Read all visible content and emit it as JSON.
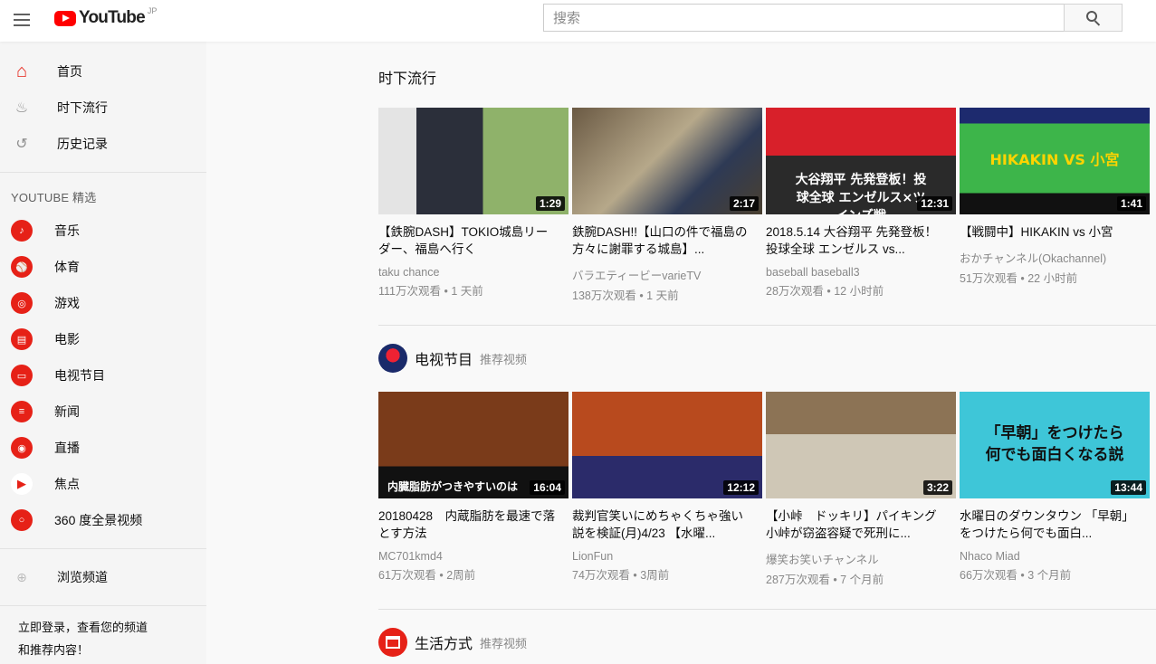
{
  "header": {
    "logo_text": "YouTube",
    "logo_region": "JP",
    "search_placeholder": "搜索"
  },
  "sidebar": {
    "main_items": [
      {
        "label": "首页",
        "icon": "home-icon"
      },
      {
        "label": "时下流行",
        "icon": "flame-icon"
      },
      {
        "label": "历史记录",
        "icon": "history-icon"
      }
    ],
    "best_title": "YOUTUBE 精选",
    "best_items": [
      {
        "label": "音乐",
        "icon": "music-icon"
      },
      {
        "label": "体育",
        "icon": "sports-icon"
      },
      {
        "label": "游戏",
        "icon": "gaming-icon"
      },
      {
        "label": "电影",
        "icon": "film-icon"
      },
      {
        "label": "电视节目",
        "icon": "tv-icon"
      },
      {
        "label": "新闻",
        "icon": "news-icon"
      },
      {
        "label": "直播",
        "icon": "live-icon"
      },
      {
        "label": "焦点",
        "icon": "spotlight-icon"
      },
      {
        "label": "360 度全景视频",
        "icon": "360-icon"
      }
    ],
    "browse_label": "浏览频道",
    "signin_text": "立即登录，查看您的频道和推荐内容！"
  },
  "shelves": [
    {
      "title": "时下流行",
      "subtitle": "",
      "videos": [
        {
          "title": "【鉄腕DASH】TOKIO城島リーダー、福島へ行く",
          "channel": "taku chance",
          "meta": "111万次观看 • 1 天前",
          "duration": "1:29"
        },
        {
          "title": "鉄腕DASH!!【山口の件で福島の方々に謝罪する城島】...",
          "channel": "バラエティービーvarieTV",
          "meta": "138万次观看 • 1 天前",
          "duration": "2:17"
        },
        {
          "title": "2018.5.14 大谷翔平 先発登板！投球全球 エンゼルス vs...",
          "channel": "baseball baseball3",
          "meta": "28万次观看 • 12 小时前",
          "duration": "12:31",
          "overlay": "大谷翔平 先発登板！投球全球 エンゼルス×ツインズ戦"
        },
        {
          "title": "【戦闘中】HIKAKIN vs 小宮",
          "channel": "おかチャンネル(Okachannel)",
          "meta": "51万次观看 • 22 小时前",
          "duration": "1:41",
          "overlay": "HIKAKIN VS 小宮"
        }
      ]
    },
    {
      "title": "电视节目",
      "subtitle": "推荐视频",
      "videos": [
        {
          "title": "20180428　内蔵脂肪を最速で落とす方法",
          "channel": "MC701kmd4",
          "meta": "61万次观看 • 2周前",
          "duration": "16:04",
          "overlay": "内臓脂肪がつきやすいのは"
        },
        {
          "title": "裁判官笑いにめちゃくちゃ強い説を検証(月)4/23 【水曜...",
          "channel": "LionFun",
          "meta": "74万次观看 • 3周前",
          "duration": "12:12"
        },
        {
          "title": "【小峠　ドッキリ】パイキング小峠が窃盗容疑で死刑に...",
          "channel": "爆笑お笑いチャンネル",
          "meta": "287万次观看 • 7 个月前",
          "duration": "3:22"
        },
        {
          "title": "水曜日のダウンタウン 「早朝」をつけたら何でも面白...",
          "channel": "Nhaco Miad",
          "meta": "66万次观看 • 3 个月前",
          "duration": "13:44",
          "overlay": "「早朝」をつけたら何でも面白くなる説"
        }
      ]
    },
    {
      "title": "生活方式",
      "subtitle": "推荐视频"
    }
  ],
  "colors": {
    "accent": "#ff0000",
    "sidebar_bg": "#f5f5f5",
    "page_bg": "#f9f9f9"
  }
}
